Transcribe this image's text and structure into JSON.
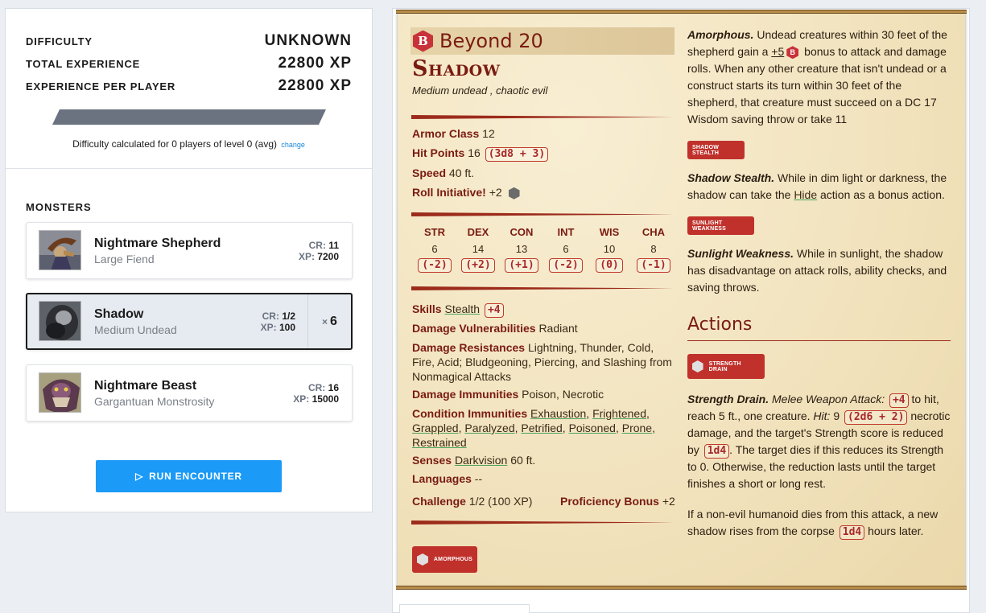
{
  "summary": {
    "difficulty_label": "DIFFICULTY",
    "difficulty_value": "UNKNOWN",
    "total_xp_label": "TOTAL EXPERIENCE",
    "total_xp_value": "22800 XP",
    "per_player_label": "EXPERIENCE PER PLAYER",
    "per_player_value": "22800 XP",
    "note": "Difficulty calculated for 0 players of level 0 (avg)",
    "change_link": "change"
  },
  "monsters": {
    "heading": "MONSTERS",
    "cr_key": "CR:",
    "xp_key": "XP:",
    "items": [
      {
        "name": "Nightmare Shepherd",
        "type": "Large Fiend",
        "cr": "11",
        "xp": "7200",
        "qty": ""
      },
      {
        "name": "Shadow",
        "type": "Medium Undead",
        "cr": "1/2",
        "xp": "100",
        "qty_x": "×",
        "qty": "6"
      },
      {
        "name": "Nightmare Beast",
        "type": "Gargantuan Monstrosity",
        "cr": "16",
        "xp": "15000",
        "qty": ""
      }
    ]
  },
  "run_button": "RUN ENCOUNTER",
  "statblock": {
    "b20_logo": "B",
    "b20_title": "Beyond 20",
    "name": "Shadow",
    "subtitle": "Medium undead , chaotic evil",
    "armor_label": "Armor Class",
    "armor_value": "12",
    "hp_label": "Hit Points",
    "hp_value": "16",
    "hp_roll": "(3d8 + 3)",
    "speed_label": "Speed",
    "speed_value": "40 ft.",
    "init_label": "Roll Initiative!",
    "init_value": "+2",
    "abilities": [
      {
        "name": "STR",
        "score": "6",
        "mod": "(-2)"
      },
      {
        "name": "DEX",
        "score": "14",
        "mod": "(+2)"
      },
      {
        "name": "CON",
        "score": "13",
        "mod": "(+1)"
      },
      {
        "name": "INT",
        "score": "6",
        "mod": "(-2)"
      },
      {
        "name": "WIS",
        "score": "10",
        "mod": "(0)"
      },
      {
        "name": "CHA",
        "score": "8",
        "mod": "(-1)"
      }
    ],
    "skills_label": "Skills",
    "skills_link": "Stealth",
    "skills_roll": "+4",
    "vuln_label": "Damage Vulnerabilities",
    "vuln_value": "Radiant",
    "resist_label": "Damage Resistances",
    "resist_value": "Lightning, Thunder, Cold, Fire, Acid; Bludgeoning, Piercing, and Slashing from Nonmagical Attacks",
    "immun_label": "Damage Immunities",
    "immun_value": "Poison, Necrotic",
    "cond_label": "Condition Immunities",
    "cond_links": [
      "Exhaustion",
      "Frightened",
      "Grappled",
      "Paralyzed",
      "Petrified",
      "Poisoned",
      "Prone",
      "Restrained"
    ],
    "senses_label": "Senses",
    "senses_link": "Darkvision",
    "senses_value": "60 ft.",
    "lang_label": "Languages",
    "lang_value": "--",
    "challenge_label": "Challenge",
    "challenge_value": "1/2 (100 XP)",
    "prof_label": "Proficiency Bonus",
    "prof_value": "+2",
    "amorphous_tag": "AMORPHOUS"
  },
  "traits": {
    "amorphous_title": "Amorphous.",
    "amorphous_text_1": "Undead creatures within 30 feet of the shepherd gain a",
    "amorphous_bonus": "+5",
    "amorphous_text_2": "bonus to attack and damage rolls. When any other creature that isn't undead or a construct starts its turn within 30 feet of the shepherd, that creature must succeed on a DC 17 Wisdom saving throw or take 11",
    "stealth_tag": "SHADOW STEALTH",
    "stealth_title": "Shadow Stealth.",
    "stealth_text_1": "While in dim light or darkness, the shadow can take the",
    "stealth_link": "Hide",
    "stealth_text_2": "action as a bonus action.",
    "sunlight_tag": "SUNLIGHT WEAKNESS",
    "sunlight_title": "Sunlight Weakness.",
    "sunlight_text": "While in sunlight, the shadow has disadvantage on attack rolls, ability checks, and saving throws."
  },
  "actions": {
    "heading": "Actions",
    "strength_tag": "STRENGTH DRAIN",
    "title": "Strength Drain.",
    "attack_type": "Melee Weapon Attack:",
    "to_hit": "+4",
    "text_1": "to hit, reach 5 ft., one creature.",
    "hit_label": "Hit:",
    "hit_value": "9",
    "dmg_roll": "(2d6 + 2)",
    "text_2": "necrotic damage, and the target's Strength score is reduced by",
    "reduce_roll": "1d4",
    "text_3": ". The target dies if this reduces its Strength to 0. Otherwise, the reduction lasts until the target finishes a short or long rest.",
    "text_4": "If a non-evil humanoid dies from this attack, a new shadow rises from the corpse",
    "rise_roll": "1d4",
    "text_5": "hours later."
  }
}
